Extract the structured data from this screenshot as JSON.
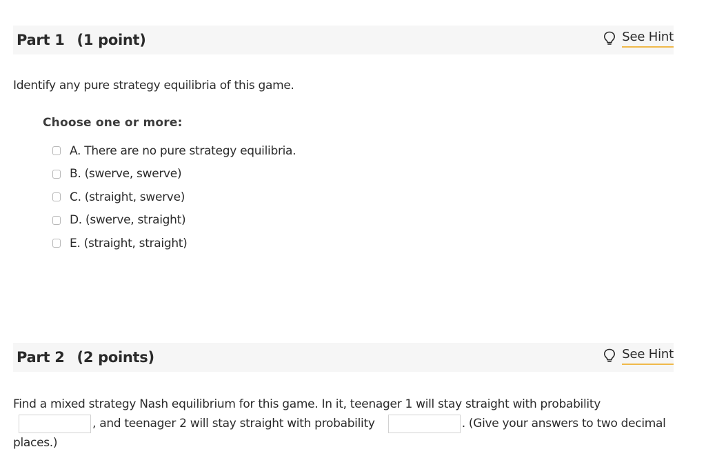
{
  "part1": {
    "title": "Part 1",
    "points": "(1 point)",
    "hint_label": "See Hint",
    "question": "Identify any pure strategy equilibria of this game.",
    "choose_label": "Choose one or more:",
    "options": [
      {
        "label": "A.  There are no pure strategy equilibria.",
        "checked": false
      },
      {
        "label": "B.  (swerve, swerve)",
        "checked": false
      },
      {
        "label": "C.  (straight, swerve)",
        "checked": false
      },
      {
        "label": "D.  (swerve, straight)",
        "checked": false
      },
      {
        "label": "E.  (straight, straight)",
        "checked": false
      }
    ]
  },
  "part2": {
    "title": "Part 2",
    "points": "(2 points)",
    "hint_label": "See Hint",
    "question_before": "Find a mixed strategy Nash equilibrium for this game. In it, teenager 1 will stay straight with probability",
    "question_middle": ", and teenager 2 will stay straight with probability",
    "question_after": ". (Give your answers to two decimal places.)",
    "answer1_value": "",
    "answer2_value": ""
  },
  "colors": {
    "hint_underline": "#f0b94a",
    "header_background": "#f6f6f6"
  },
  "icons": {
    "hint": "lightbulb-icon"
  }
}
